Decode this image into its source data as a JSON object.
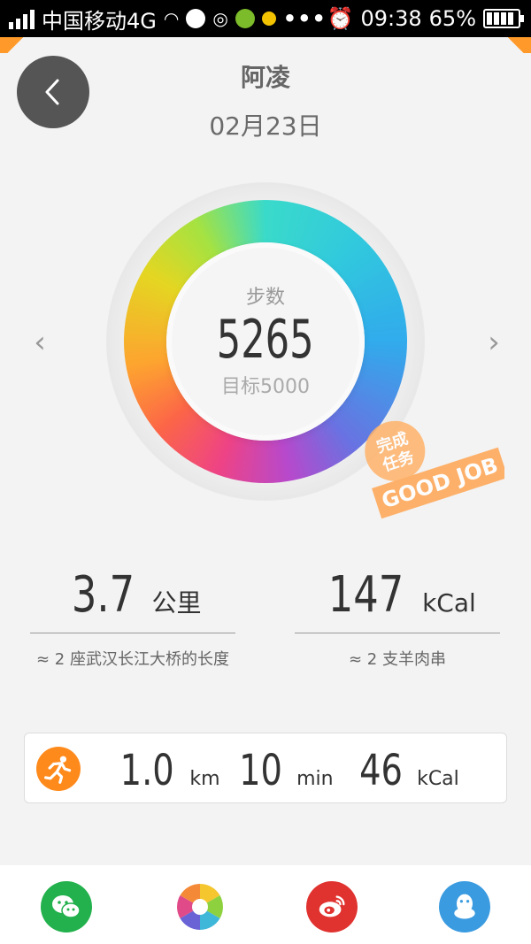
{
  "status_bar": {
    "carrier": "中国移动4G",
    "time": "09:38",
    "battery": "65%",
    "more": "•••"
  },
  "header": {
    "name": "阿凌",
    "date": "02月23日"
  },
  "ring": {
    "label": "步数",
    "steps": "5265",
    "goal": "目标5000",
    "progress_fraction": 1.0
  },
  "stamp": {
    "line1": "完成",
    "line2": "任务",
    "text": "GOOD JOB"
  },
  "metrics": [
    {
      "value": "3.7",
      "unit": "公里",
      "note": "≈ 2 座武汉长江大桥的长度"
    },
    {
      "value": "147",
      "unit": "kCal",
      "note": "≈ 2 支羊肉串"
    }
  ],
  "workout": {
    "distance": "1.0",
    "distance_unit": "km",
    "duration": "10",
    "duration_unit": "min",
    "calories": "46",
    "calories_unit": "kCal"
  },
  "share_icons": [
    "wechat-icon",
    "album-icon",
    "weibo-icon",
    "qq-icon"
  ],
  "colors": {
    "accent_orange": "#ff8a1c",
    "wechat": "#22b14c",
    "weibo": "#e0322f",
    "qq": "#3a9be0"
  }
}
